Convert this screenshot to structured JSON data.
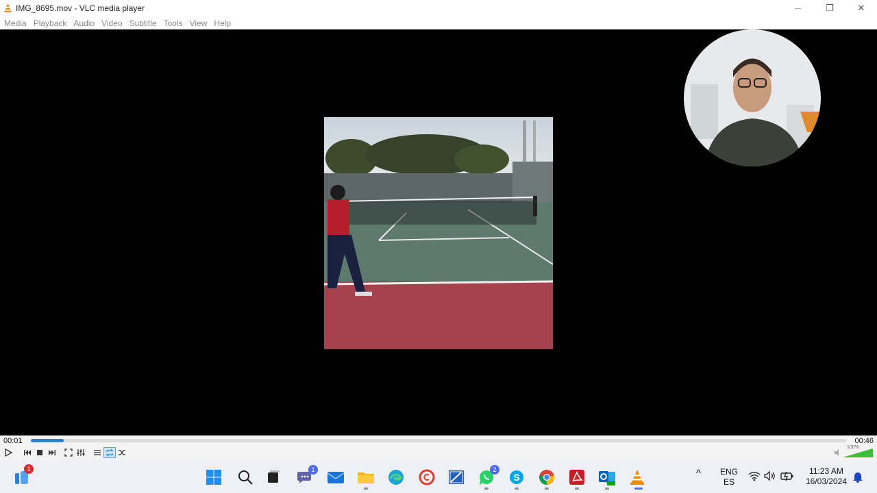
{
  "window": {
    "title": "IMG_8695.mov - VLC media player",
    "minimize_glyph": "—",
    "maximize_glyph": "❐",
    "close_glyph": "✕"
  },
  "menu": [
    "Media",
    "Playback",
    "Audio",
    "Video",
    "Subtitle",
    "Tools",
    "View",
    "Help"
  ],
  "player": {
    "elapsed": "00:01",
    "duration": "00:46",
    "progress_fraction": 0.04,
    "volume_label": "100%",
    "volume_fraction": 1.0
  },
  "taskbar": {
    "widgets_badge": "1",
    "teams_badge": "1",
    "whatsapp_badge": "2",
    "chevron": "^",
    "language_top": "ENG",
    "language_bottom": "ES",
    "time": "11:23 AM",
    "date": "16/03/2024"
  },
  "colors": {
    "accent": "#2f7fd6",
    "vlc_orange": "#f08a00",
    "badge_red": "#d92b2b",
    "badge_blue": "#4f6bed"
  }
}
